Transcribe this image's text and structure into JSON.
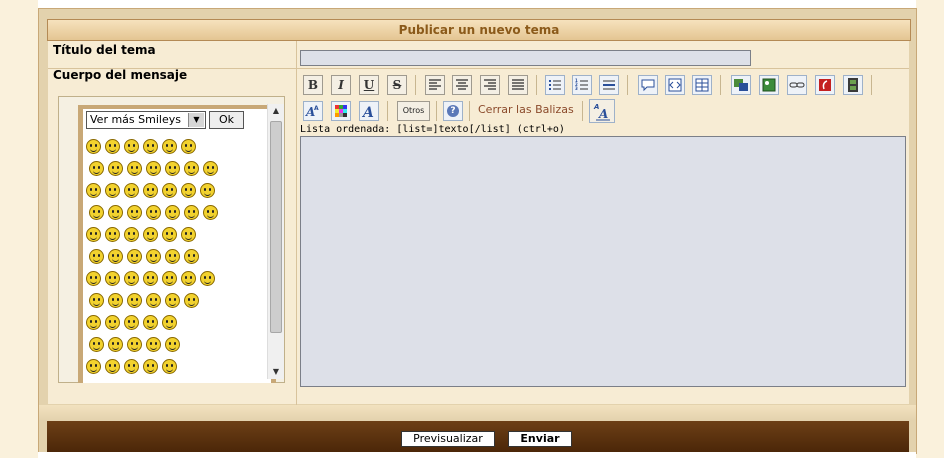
{
  "form": {
    "title": "Publicar un nuevo tema",
    "topic_title_label": "Título del tema",
    "topic_title_value": "",
    "body_label": "Cuerpo del mensaje",
    "body_value": ""
  },
  "toolbar": {
    "row1": [
      {
        "name": "bold-button",
        "icon": "B",
        "style": "bold"
      },
      {
        "name": "italic-button",
        "icon": "I",
        "style": "italic"
      },
      {
        "name": "underline-button",
        "icon": "U",
        "style": "underline"
      },
      {
        "name": "strikethrough-button",
        "icon": "S",
        "style": "strike"
      },
      {
        "name": "align-left-button",
        "icon": "align-left-icon"
      },
      {
        "name": "align-center-button",
        "icon": "align-center-icon"
      },
      {
        "name": "align-right-button",
        "icon": "align-right-icon"
      },
      {
        "name": "justify-button",
        "icon": "justify-icon"
      },
      {
        "name": "unordered-list-button",
        "icon": "bullet-list-icon"
      },
      {
        "name": "ordered-list-button",
        "icon": "numbered-list-icon"
      },
      {
        "name": "horizontal-rule-button",
        "icon": "hr-icon"
      },
      {
        "name": "quote-button",
        "icon": "speech-bubble-icon"
      },
      {
        "name": "code-button",
        "icon": "code-icon"
      },
      {
        "name": "table-button",
        "icon": "table-icon"
      },
      {
        "name": "image-host-button",
        "icon": "image-host-icon"
      },
      {
        "name": "image-button",
        "icon": "image-icon"
      },
      {
        "name": "link-button",
        "icon": "link-icon"
      },
      {
        "name": "flash-button",
        "icon": "flash-icon"
      },
      {
        "name": "video-button",
        "icon": "film-icon"
      }
    ],
    "row2": [
      {
        "name": "font-size-button",
        "icon": "font-size-icon"
      },
      {
        "name": "color-button",
        "icon": "color-grid-icon"
      },
      {
        "name": "font-face-button",
        "icon": "font-face-icon"
      }
    ],
    "otros_label": "Otros",
    "help_icon": "help-icon",
    "close_tags_label": "Cerrar las Balizas",
    "format_toggle_label": "A",
    "hint_text": "Lista ordenada: [list=]texto[/list] (ctrl+o)"
  },
  "smileys": {
    "select_value": "Ver más Smileys",
    "ok_label": "Ok",
    "colors": {
      "face": "#f2d22e",
      "outline": "#8a6a00"
    }
  },
  "footer": {
    "preview_label": "Previsualizar",
    "send_label": "Enviar"
  },
  "colors": {
    "title_text": "#8b5a1a",
    "panel_bg": "#f7ecd4",
    "frame_bg": "#e3d2ad",
    "editor_bg": "#dde0e8",
    "footer_bg": "#5a300e",
    "link_color": "#8b4a2b"
  }
}
